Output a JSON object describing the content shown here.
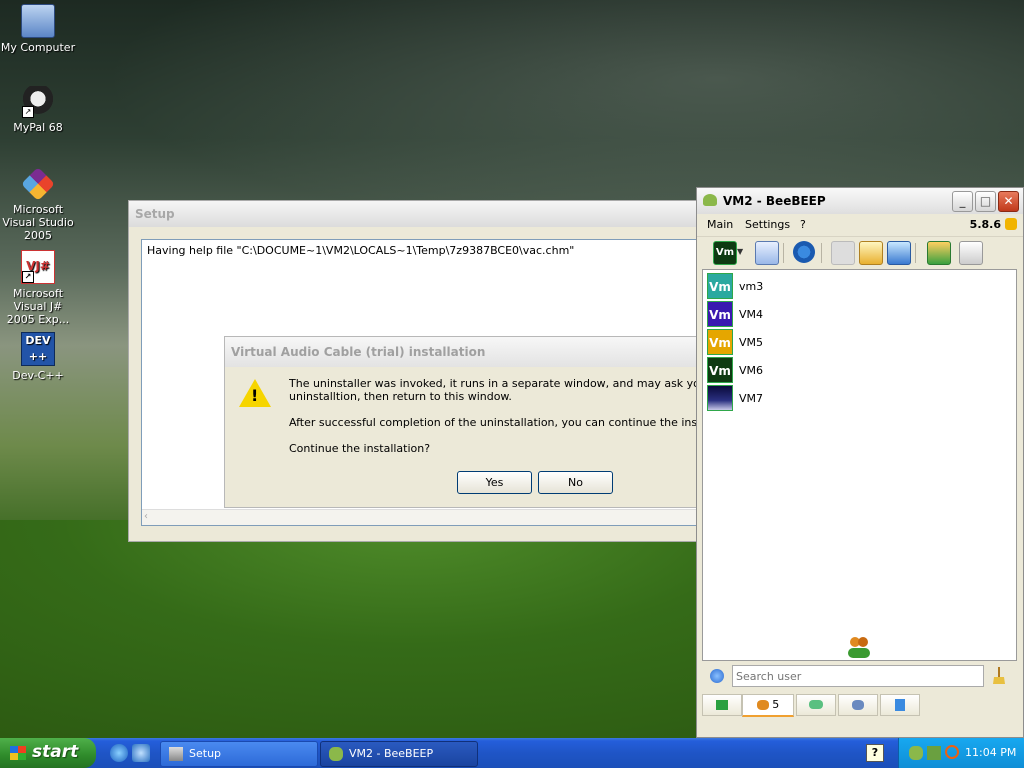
{
  "desktop": {
    "icons": [
      {
        "label": "My Computer"
      },
      {
        "label": "MyPal 68"
      },
      {
        "label": "Microsoft Visual Studio 2005"
      },
      {
        "label": "Microsoft Visual J# 2005 Exp..."
      },
      {
        "label": "Dev-C++"
      }
    ]
  },
  "setup_window": {
    "title": "Setup",
    "log_text": "Having help file \"C:\\DOCUME~1\\VM2\\LOCALS~1\\Temp\\7z9387BCE0\\vac.chm\""
  },
  "vac_dialog": {
    "title": "Virtual Audio Cable (trial) installation",
    "line1": "The uninstaller was invoked, it runs in a separate window, and may ask you some que",
    "line2": "uninstalltion, then return to this window.",
    "line3": "After successful completion of the uninstallation, you can continue the installation her",
    "line4": "Continue the installation?",
    "yes_label": "Yes",
    "no_label": "No"
  },
  "beebeep": {
    "title": "VM2 - BeeBEEP",
    "menu": {
      "main": "Main",
      "settings": "Settings",
      "help": "?"
    },
    "version": "5.8.6",
    "users": [
      {
        "avatar": "Vm",
        "name": "vm3",
        "color": "#2aa9a0"
      },
      {
        "avatar": "Vm",
        "name": "VM4",
        "color": "#3a18b0"
      },
      {
        "avatar": "Vm",
        "name": "VM5",
        "color": "#e5a600"
      },
      {
        "avatar": "Vm",
        "name": "VM6",
        "color": "#0e3a12"
      },
      {
        "avatar": "",
        "name": "VM7",
        "color": "#14185a"
      }
    ],
    "search_placeholder": "Search user",
    "tab_users_count": "5"
  },
  "taskbar": {
    "start_label": "start",
    "tasks": [
      {
        "label": "Setup"
      },
      {
        "label": "VM2 - BeeBEEP"
      }
    ],
    "clock": "11:04 PM"
  }
}
